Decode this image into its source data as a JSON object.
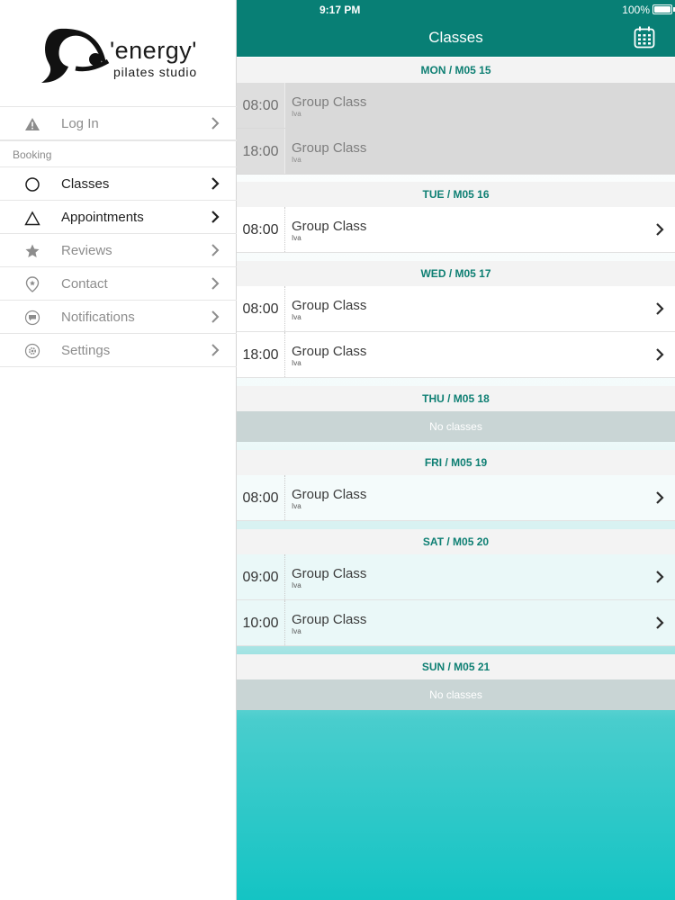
{
  "status": {
    "time": "9:17 PM",
    "battery": "100%"
  },
  "nav": {
    "title": "Classes"
  },
  "logo": {
    "word": "'energy'",
    "sub": "pilates studio"
  },
  "sidebar": {
    "login": "Log In",
    "section": "Booking",
    "items": [
      {
        "label": "Classes",
        "icon": "circle-icon"
      },
      {
        "label": "Appointments",
        "icon": "triangle-icon"
      },
      {
        "label": "Reviews",
        "icon": "star-icon"
      },
      {
        "label": "Contact",
        "icon": "location-pin-icon"
      },
      {
        "label": "Notifications",
        "icon": "chat-bubble-icon"
      },
      {
        "label": "Settings",
        "icon": "gear-icon"
      }
    ]
  },
  "schedule": [
    {
      "day": "MON / M05 15",
      "classes": [
        {
          "time": "08:00",
          "name": "Group Class",
          "instructor": "Iva"
        },
        {
          "time": "18:00",
          "name": "Group Class",
          "instructor": "Iva"
        }
      ]
    },
    {
      "day": "TUE / M05 16",
      "classes": [
        {
          "time": "08:00",
          "name": "Group Class",
          "instructor": "Iva"
        }
      ]
    },
    {
      "day": "WED / M05 17",
      "classes": [
        {
          "time": "08:00",
          "name": "Group Class",
          "instructor": "Iva"
        },
        {
          "time": "18:00",
          "name": "Group Class",
          "instructor": "Iva"
        }
      ]
    },
    {
      "day": "THU / M05 18",
      "empty": "No classes"
    },
    {
      "day": "FRI / M05 19",
      "classes": [
        {
          "time": "08:00",
          "name": "Group Class",
          "instructor": "Iva"
        }
      ]
    },
    {
      "day": "SAT / M05 20",
      "classes": [
        {
          "time": "09:00",
          "name": "Group Class",
          "instructor": "Iva"
        },
        {
          "time": "10:00",
          "name": "Group Class",
          "instructor": "Iva"
        }
      ]
    },
    {
      "day": "SUN / M05 21",
      "empty": "No classes"
    }
  ],
  "colors": {
    "accent": "#087f75",
    "header_text": "#0e7f73",
    "no_classes": "#c9d5d5"
  }
}
